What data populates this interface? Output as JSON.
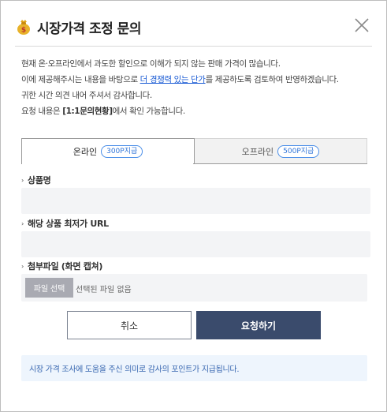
{
  "header": {
    "title": "시장가격 조정 문의",
    "title_icon": "money-bag-icon",
    "close_icon": "close-icon"
  },
  "description": {
    "line1": "현재 온·오프라인에서 과도한 할인으로 이해가 되지 않는 판매 가격이 많습니다.",
    "line2_before": "이에 제공해주시는 내용을 바탕으로 ",
    "line2_link": "더 경쟁력 있는 단가",
    "line2_after": "를 제공하도록 검토하여 반영하겠습니다.",
    "line3": "귀한 시간 의견 내어 주셔서 감사합니다.",
    "line4_before": "요청 내용은 ",
    "line4_bold": "[1:1문의현황]",
    "line4_after": "에서 확인 가능합니다."
  },
  "tabs": [
    {
      "label": "온라인",
      "badge": "300P지급",
      "active": true
    },
    {
      "label": "오프라인",
      "badge": "500P지급",
      "active": false
    }
  ],
  "form": {
    "product_name_label": "상품명",
    "product_name_value": "",
    "url_label": "해당 상품 최저가 URL",
    "url_value": "",
    "attachment_label": "첨부파일 (화면 캡쳐)",
    "file_button_label": "파일 선택",
    "file_status": "선택된 파일 없음"
  },
  "buttons": {
    "cancel": "취소",
    "submit": "요청하기"
  },
  "notice": "시장 가격 조사에 도움을 주신 의미로 감사의 포인트가 지급됩니다.",
  "colors": {
    "accent_link": "#1a5bd4",
    "badge": "#2f74d8",
    "submit_bg": "#3a4b6c",
    "notice_bg": "#eef5fd",
    "notice_text": "#3766b0"
  }
}
